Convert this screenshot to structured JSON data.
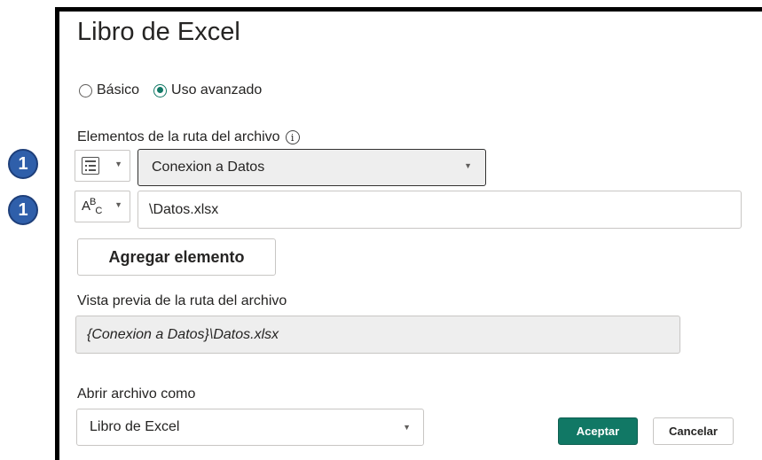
{
  "dialog": {
    "title": "Libro de Excel"
  },
  "mode": {
    "options": [
      {
        "label": "Básico",
        "checked": false
      },
      {
        "label": "Uso avanzado",
        "checked": true
      }
    ]
  },
  "path_parts": {
    "label": "Elementos de la ruta del archivo",
    "info_icon": "info-icon",
    "rows": [
      {
        "badge": "1",
        "type_icon": "parameter-icon",
        "value": "Conexion a Datos",
        "kind": "dropdown"
      },
      {
        "badge": "1",
        "type_icon": "text-abc-icon",
        "value": "\\Datos.xlsx",
        "kind": "text"
      }
    ],
    "add_button_label": "Agregar elemento"
  },
  "preview": {
    "label": "Vista previa de la ruta del archivo",
    "value": "{Conexion a Datos}\\Datos.xlsx"
  },
  "open_as": {
    "label": "Abrir archivo como",
    "value": "Libro de Excel"
  },
  "actions": {
    "ok_label": "Aceptar",
    "cancel_label": "Cancelar"
  },
  "colors": {
    "accent": "#117865",
    "badge": "#2f5faa"
  }
}
